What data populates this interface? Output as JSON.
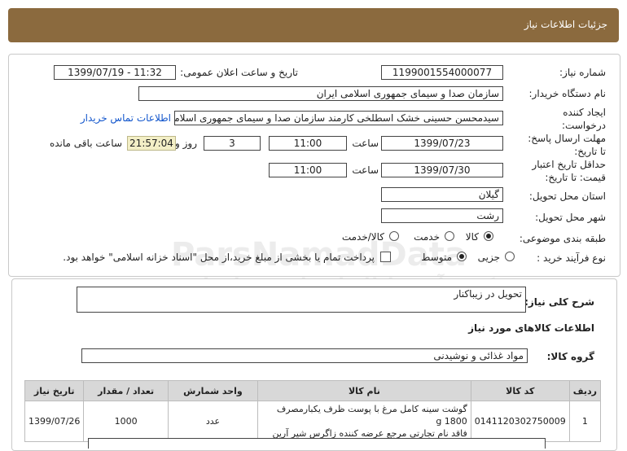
{
  "header": {
    "title": "جزئیات اطلاعات نیاز"
  },
  "form": {
    "need_number_label": "شماره نیاز:",
    "need_number": "1199001554000077",
    "announce_label": "تاریخ و ساعت اعلان عمومی:",
    "announce_value": "1399/07/19 - 11:32",
    "buyer_org_label": "نام دستگاه خریدار:",
    "buyer_org": "سازمان صدا و سیمای جمهوری اسلامی ایران",
    "creator_label_1": "ایجاد کننده",
    "creator_label_2": "درخواست:",
    "creator": "سیدمحسن حسینی خشک اسطلخی کارمند سازمان صدا و سیمای جمهوری اسلامی ایران",
    "contact_link": "اطلاعات تماس خریدار",
    "deadline_label_1": "مهلت ارسال پاسخ:",
    "deadline_label_2": "تا تاریخ:",
    "deadline_date": "1399/07/23",
    "time_label": "ساعت",
    "deadline_time": "11:00",
    "days_value": "3",
    "days_label": "روز و",
    "remaining_time": "21:57:04",
    "remaining_label": "ساعت باقی مانده",
    "validity_label_1": "حداقل تاریخ اعتبار",
    "validity_label_2": "قیمت: تا تاریخ:",
    "validity_date": "1399/07/30",
    "validity_time": "11:00",
    "province_label": "استان محل تحویل:",
    "province": "گیلان",
    "city_label": "شهر محل تحویل:",
    "city": "رشت",
    "category_label": "طبقه بندی موضوعی:",
    "category_options": [
      "کالا",
      "خدمت",
      "کالا/خدمت"
    ],
    "process_label": "نوع فرآیند خرید :",
    "process_options": [
      "جزیی",
      "متوسط"
    ],
    "process_note": "پرداخت تمام یا بخشی از مبلغ خرید،از محل \"اسناد خزانه اسلامی\" خواهد بود."
  },
  "details": {
    "summary_label": "شرح کلی نیاز:",
    "summary": "تحویل در زیباکنار",
    "goods_info_title": "اطلاعات کالاهای مورد نیاز",
    "group_label": "گروه کالا:",
    "group_value": "مواد غذائی و نوشیدنی"
  },
  "table": {
    "headers": {
      "row": "ردیف",
      "code": "کد کالا",
      "name": "نام کالا",
      "unit": "واحد شمارش",
      "qty": "تعداد / مقدار",
      "date": "تاریخ نیاز"
    },
    "rows": [
      {
        "row": "1",
        "code": "0141120302750009",
        "name_line1": "گوشت سینه کامل مرغ با پوست ظرف یکبارمصرف 1800 g",
        "name_line2": "فاقد نام تجارتی مرجع عرضه کننده زاگرس شیر آرین",
        "unit": "عدد",
        "qty": "1000",
        "date": "1399/07/26"
      }
    ]
  },
  "watermark": {
    "line1": "ParsNamadData",
    "line2": "مرکز فرآوری اطلاعات پارس نماد داده",
    "line3": "پایگاه اطلاع رسانی مناقصه و مزایده",
    "line4": "۰۲۱-۸۸۳۴۹۶۷۰-۵"
  },
  "colors": {
    "header_bg": "#8b6a3e",
    "link": "#1155cc",
    "remaining_bg": "#f3efc6",
    "table_header_bg": "#d8d8d8"
  }
}
